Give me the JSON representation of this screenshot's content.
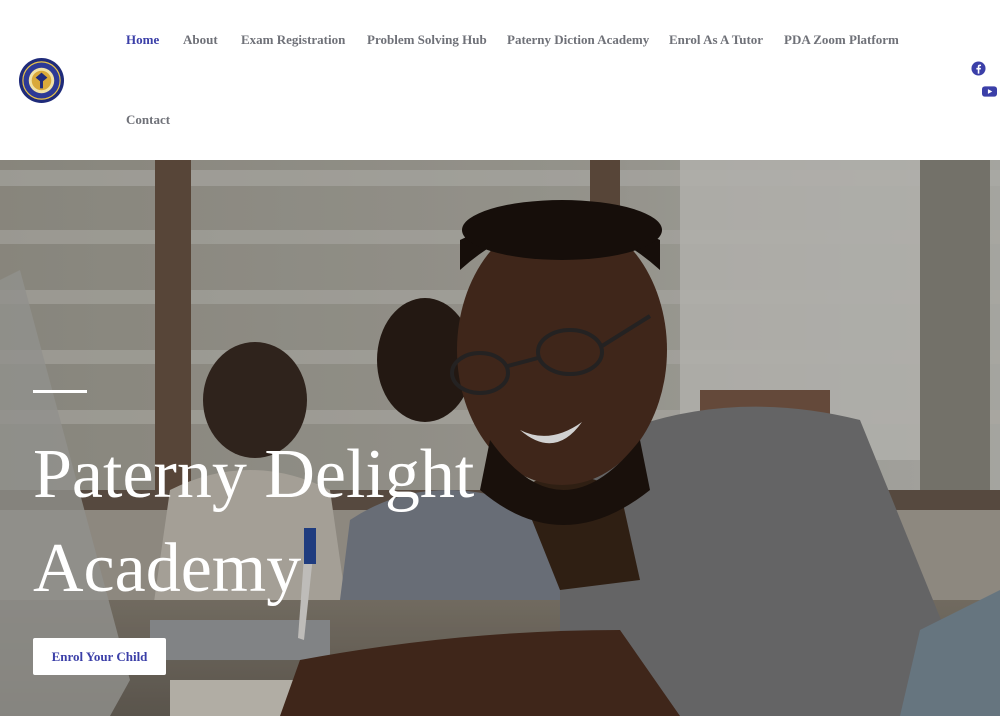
{
  "site": {
    "logo_icon": "academy-crest-logo"
  },
  "nav": {
    "items": [
      {
        "label": "Home",
        "active": true
      },
      {
        "label": "About"
      },
      {
        "label": "Exam Registration"
      },
      {
        "label": "Problem Solving Hub"
      },
      {
        "label": "Paterny Diction Academy"
      },
      {
        "label": "Enrol As A Tutor"
      },
      {
        "label": "PDA Zoom Platform"
      },
      {
        "label": "Contact"
      }
    ]
  },
  "social": {
    "facebook_icon": "facebook-icon",
    "youtube_icon": "youtube-icon",
    "brand_color": "#3b3fa8"
  },
  "hero": {
    "title": "Paterny Delight Academy",
    "cta_label": "Enrol Your Child",
    "overlay_color": "#000000"
  },
  "colors": {
    "accent": "#3b3fa8",
    "nav_text": "#6f7178",
    "hero_text": "#ffffff"
  }
}
